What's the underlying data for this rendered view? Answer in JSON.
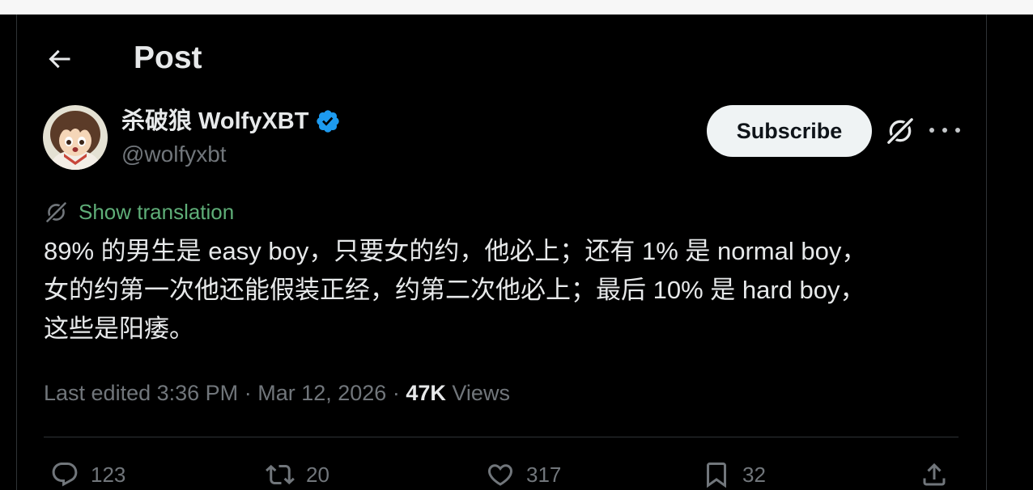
{
  "header": {
    "title": "Post",
    "back_icon": "arrow-left-icon"
  },
  "author": {
    "name": "杀破狼 WolfyXBT",
    "handle": "@wolfyxbt",
    "verified_icon": "verified-badge-icon",
    "avatar_icon": "avatar-image"
  },
  "subscribe": {
    "label": "Subscribe"
  },
  "toolbar_icons": {
    "grok": "grok-icon",
    "more": "more-icon"
  },
  "translation": {
    "label": "Show translation",
    "icon": "translate-icon"
  },
  "post": {
    "text_lines": [
      "89% 的男生是 easy boy，只要女的约，他必上；还有 1% 是 normal boy，",
      "女的约第一次他还能假装正经，约第二次他必上；最后 10% 是 hard boy，",
      "这些是阳痿。"
    ]
  },
  "meta": {
    "edited_label": "Last edited",
    "time": "3:36 PM",
    "separator": "·",
    "date": "Mar 12, 2026",
    "views_count": "47K",
    "views_label": "Views"
  },
  "actions": [
    {
      "icon": "reply-icon",
      "count": "123"
    },
    {
      "icon": "repost-icon",
      "count": "20"
    },
    {
      "icon": "like-icon",
      "count": "317"
    },
    {
      "icon": "bookmark-icon",
      "count": "32"
    },
    {
      "icon": "share-icon"
    }
  ],
  "colors": {
    "background": "#000000",
    "text": "#e7e9ea",
    "muted": "#71767b",
    "accent": "#1d9bf0",
    "translation": "#5fae78",
    "border": "#2f3336"
  }
}
